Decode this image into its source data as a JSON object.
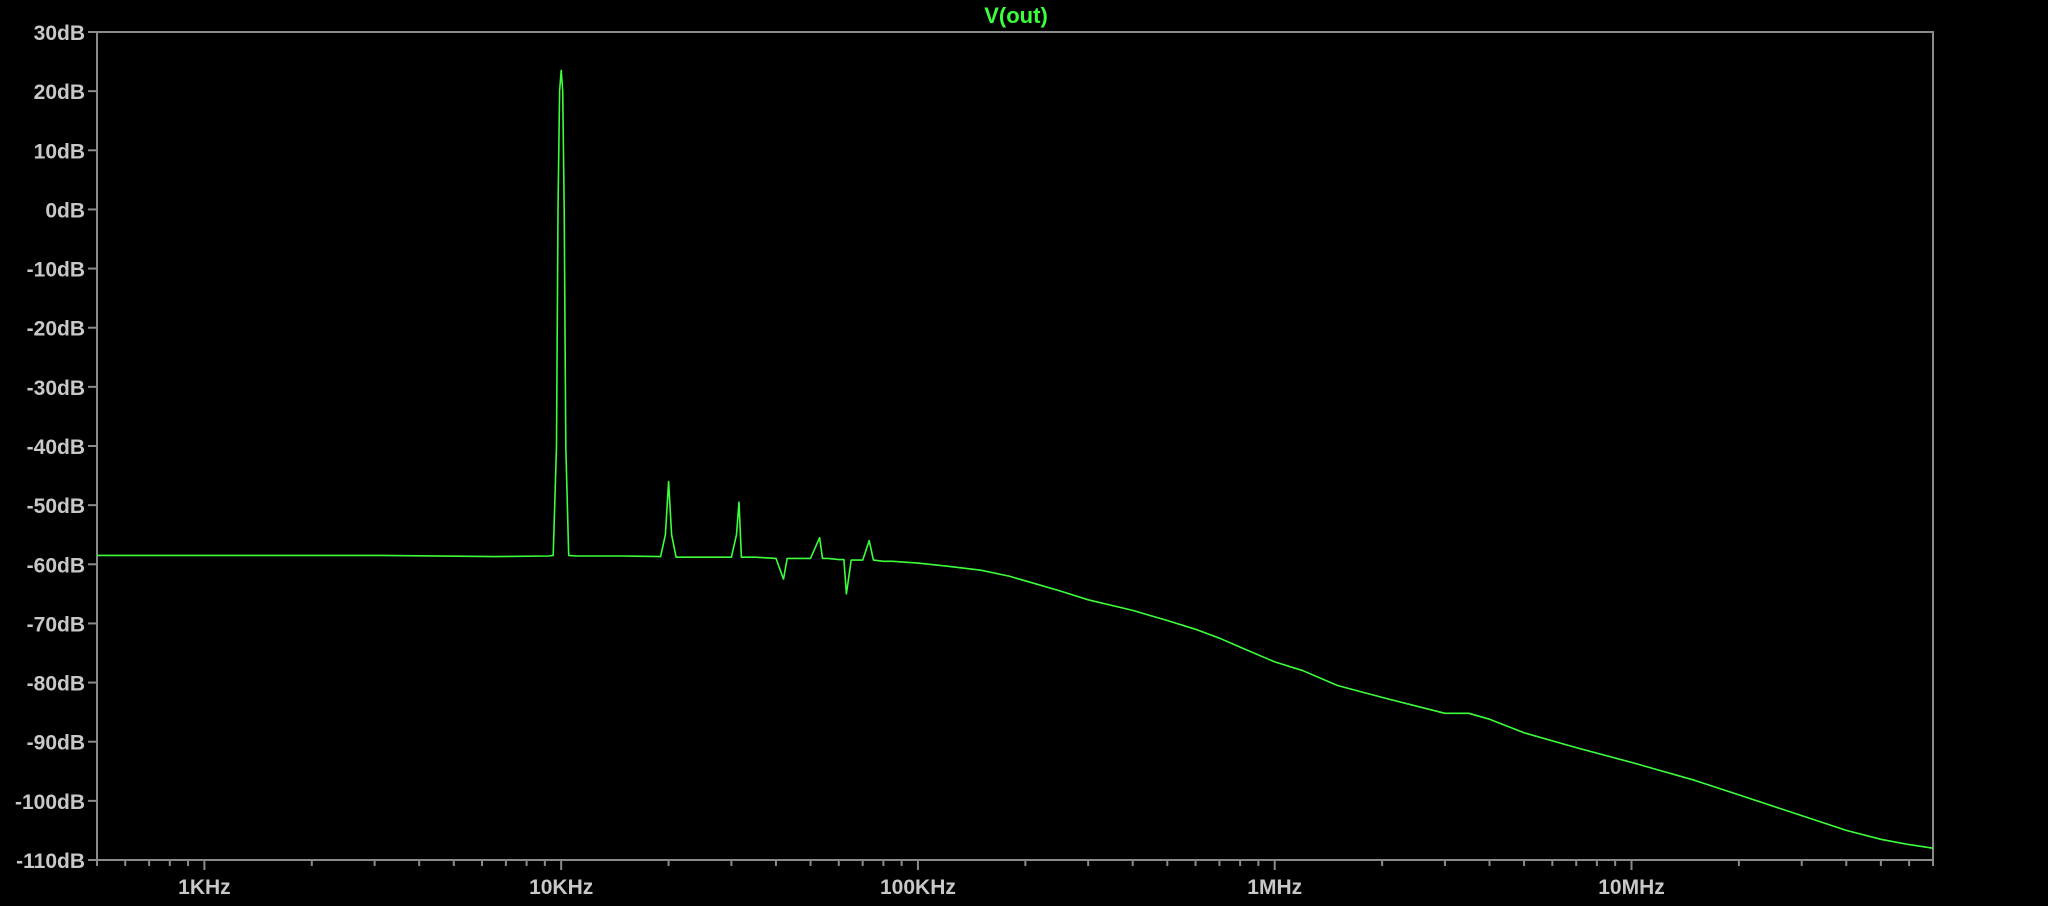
{
  "chart_data": {
    "type": "line",
    "title": "V(out)",
    "xlabel": "",
    "ylabel": "",
    "x_scale": "log",
    "xlim": [
      500,
      70000000
    ],
    "ylim": [
      -110,
      30
    ],
    "grid": false,
    "y_ticks": [
      {
        "value": 30,
        "label": "30dB"
      },
      {
        "value": 20,
        "label": "20dB"
      },
      {
        "value": 10,
        "label": "10dB"
      },
      {
        "value": 0,
        "label": "0dB"
      },
      {
        "value": -10,
        "label": "-10dB"
      },
      {
        "value": -20,
        "label": "-20dB"
      },
      {
        "value": -30,
        "label": "-30dB"
      },
      {
        "value": -40,
        "label": "-40dB"
      },
      {
        "value": -50,
        "label": "-50dB"
      },
      {
        "value": -60,
        "label": "-60dB"
      },
      {
        "value": -70,
        "label": "-70dB"
      },
      {
        "value": -80,
        "label": "-80dB"
      },
      {
        "value": -90,
        "label": "-90dB"
      },
      {
        "value": -100,
        "label": "-100dB"
      },
      {
        "value": -110,
        "label": "-110dB"
      }
    ],
    "x_ticks": [
      {
        "value": 1000,
        "label": "1KHz"
      },
      {
        "value": 10000,
        "label": "10KHz"
      },
      {
        "value": 100000,
        "label": "100KHz"
      },
      {
        "value": 1000000,
        "label": "1MHz"
      },
      {
        "value": 10000000,
        "label": "10MHz"
      }
    ],
    "series": [
      {
        "color": "#3cff3c",
        "x": [
          500,
          1000,
          3000,
          6500,
          9200,
          9500,
          9700,
          9800,
          9900,
          10000,
          10100,
          10200,
          10300,
          10500,
          11000,
          15000,
          19000,
          19600,
          20000,
          20400,
          21000,
          25000,
          30000,
          31000,
          31500,
          32000,
          35000,
          40000,
          42000,
          43000,
          45000,
          50000,
          53000,
          54000,
          56000,
          60000,
          62000,
          63000,
          65000,
          70000,
          73000,
          75000,
          80000,
          85000,
          90000,
          100000,
          120000,
          150000,
          180000,
          200000,
          250000,
          300000,
          400000,
          500000,
          600000,
          700000,
          800000,
          1000000,
          1200000,
          1500000,
          2000000,
          2500000,
          3000000,
          3500000,
          4000000,
          5000000,
          7000000,
          10000000,
          15000000,
          20000000,
          30000000,
          40000000,
          50000000,
          60000000,
          70000000
        ],
        "y": [
          -58.5,
          -58.5,
          -58.5,
          -58.7,
          -58.6,
          -58.5,
          -40,
          0,
          20,
          23.5,
          20,
          0,
          -40,
          -58.5,
          -58.6,
          -58.6,
          -58.7,
          -55,
          -46,
          -55,
          -58.8,
          -58.8,
          -58.8,
          -55,
          -49.5,
          -58.8,
          -58.8,
          -59,
          -62.5,
          -59,
          -59,
          -59,
          -55.5,
          -59,
          -59,
          -59.2,
          -59.2,
          -65,
          -59.3,
          -59.3,
          -56,
          -59.3,
          -59.5,
          -59.5,
          -59.6,
          -59.8,
          -60.3,
          -61,
          -62,
          -62.8,
          -64.5,
          -66,
          -67.8,
          -69.5,
          -71,
          -72.5,
          -74,
          -76.5,
          -78,
          -80.5,
          -82.5,
          -84,
          -85.2,
          -85.2,
          -86.2,
          -88.5,
          -91,
          -93.5,
          -96.5,
          -99,
          -102.5,
          -105,
          -106.5,
          -107.4,
          -108
        ]
      }
    ]
  }
}
